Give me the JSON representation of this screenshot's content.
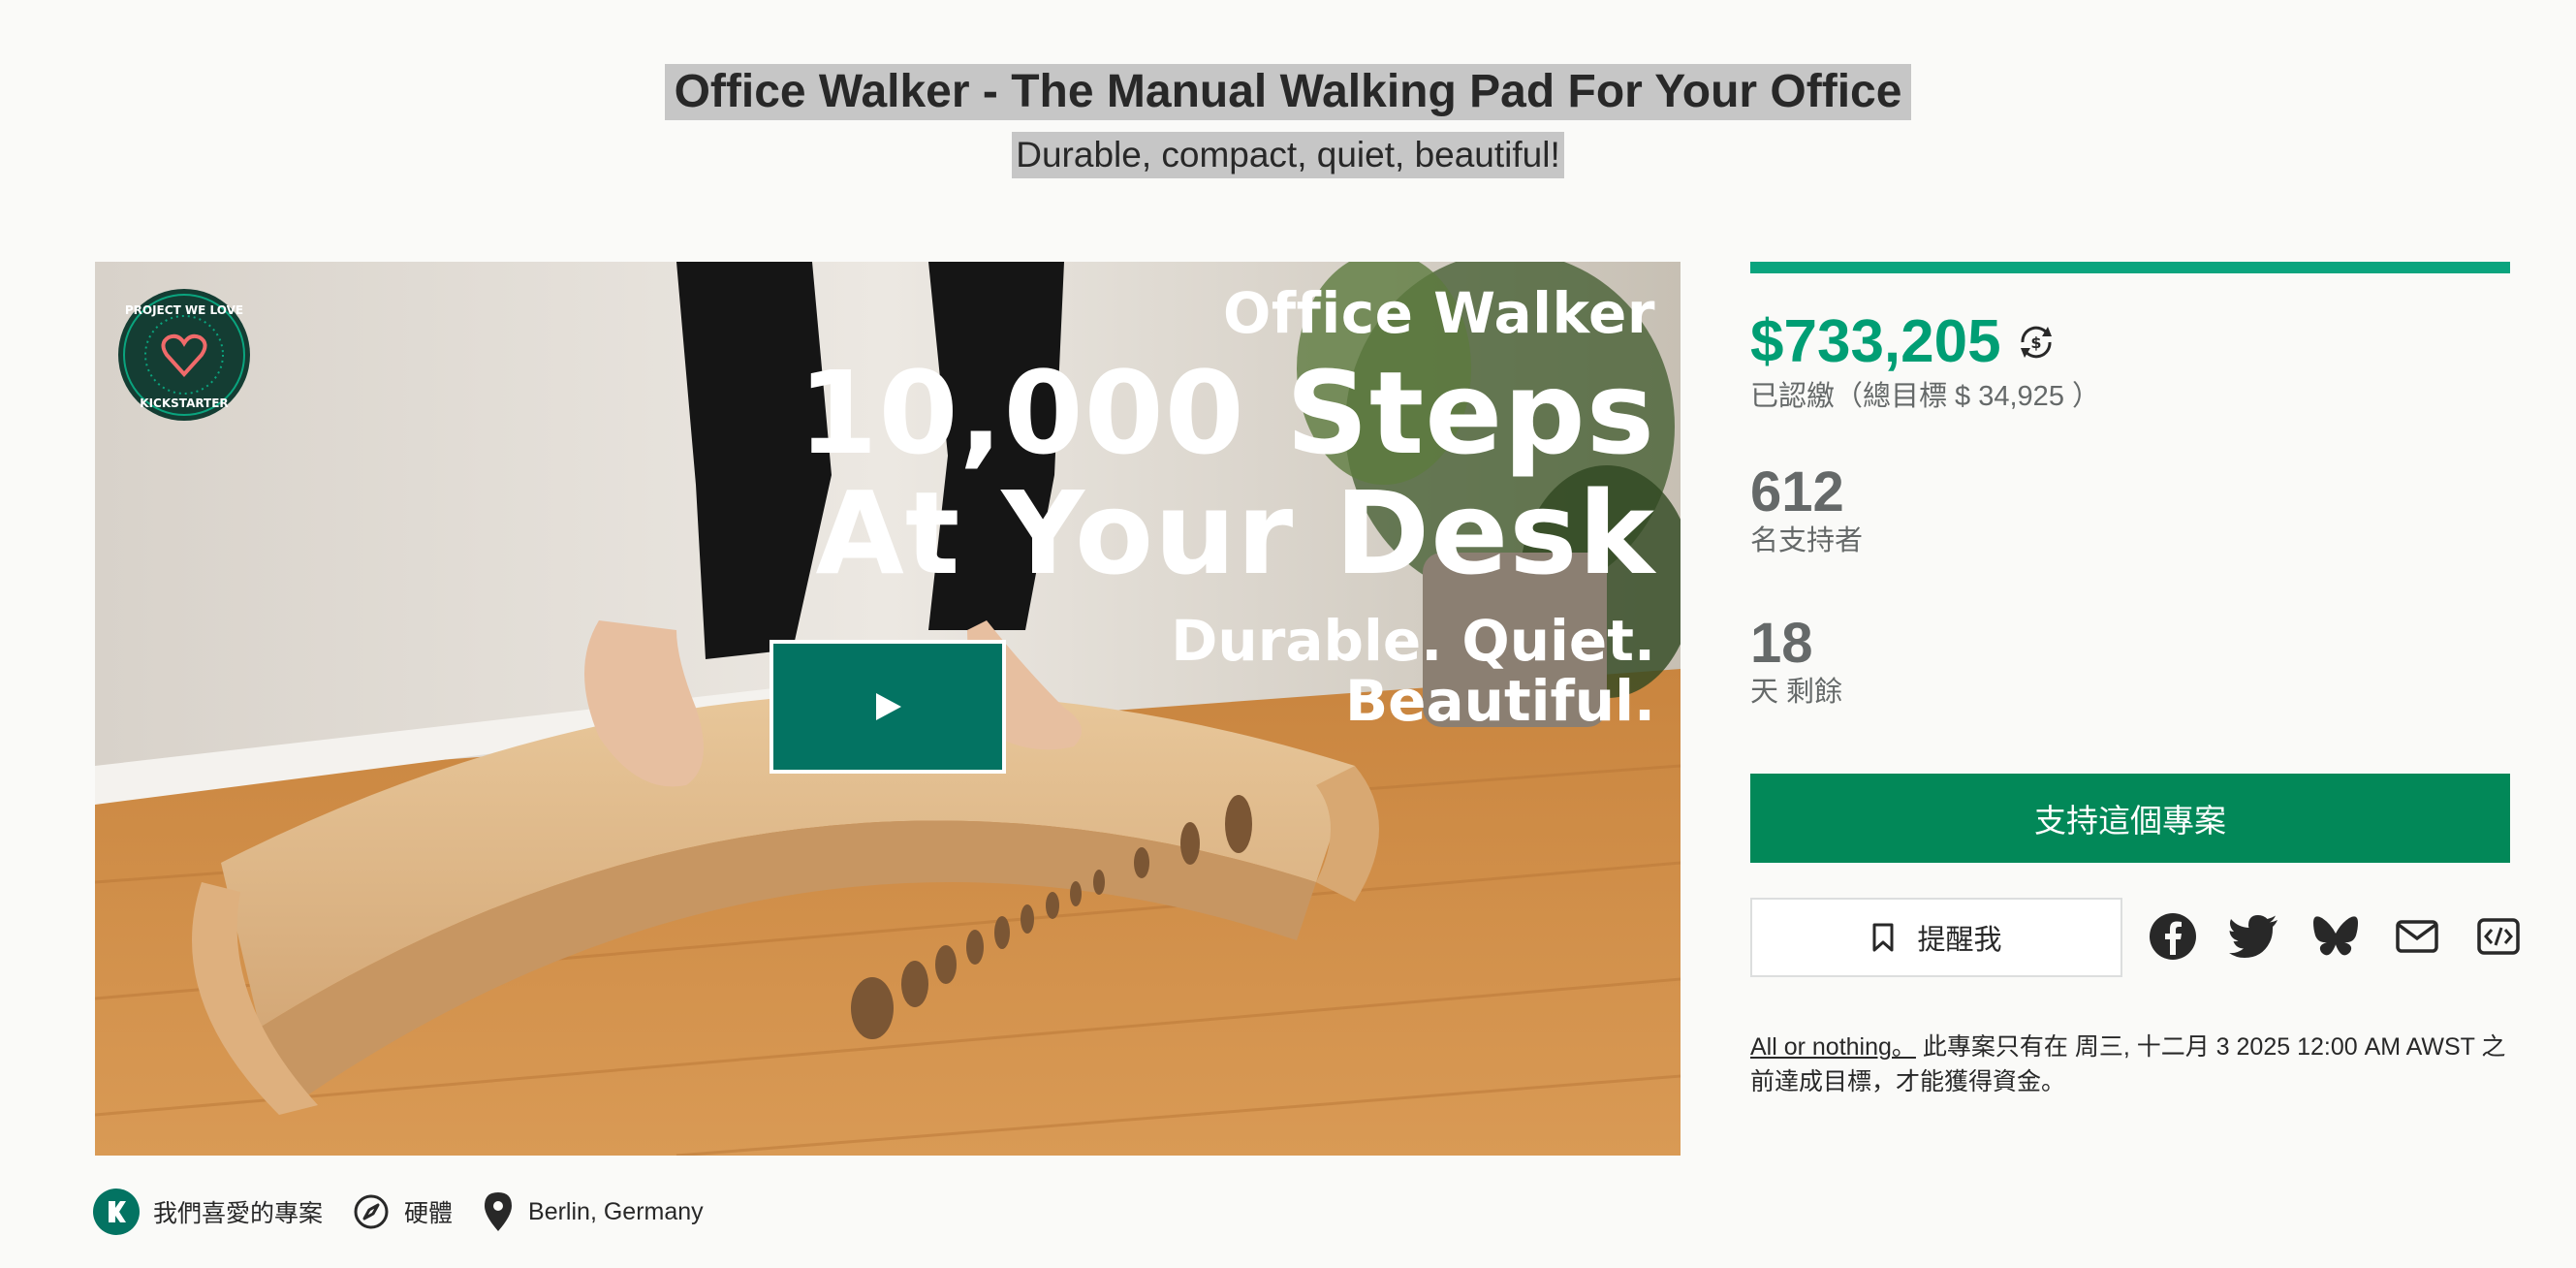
{
  "header": {
    "title": "Office Walker - The Manual Walking Pad For Your Office",
    "subtitle": "Durable, compact, quiet, beautiful!"
  },
  "media": {
    "badge_top": "PROJECT WE LOVE",
    "badge_bottom": "KICKSTARTER",
    "overlay_brand": "Office Walker",
    "overlay_headline_1": "10,000 Steps",
    "overlay_headline_2": "At Your Desk",
    "overlay_tag_1": "Durable. Quiet.",
    "overlay_tag_2": "Beautiful.",
    "play_icon": "play-icon"
  },
  "stats": {
    "progress_fraction": 1.0,
    "pledged": "$733,205",
    "pledged_label": "已認繳（總目標 $ 34,925 ）",
    "backers": "612",
    "backers_label": "名支持者",
    "days": "18",
    "days_label": "天 剩餘"
  },
  "actions": {
    "back_label": "支持這個專案",
    "remind_label": "提醒我",
    "share_icons": [
      "facebook-icon",
      "twitter-icon",
      "bluesky-icon",
      "email-icon",
      "embed-icon"
    ]
  },
  "funding_note": {
    "link": "All or nothing。",
    "text": " 此專案只有在 周三, 十二月 3 2025 12:00 AM AWST 之前達成目標，才能獲得資金。"
  },
  "tags": {
    "pwl": "我們喜愛的專案",
    "category": "硬體",
    "location": "Berlin, Germany"
  },
  "colors": {
    "accent": "#009e74",
    "button": "#028858",
    "play": "#037362",
    "title_highlight": "#c6c6c6"
  }
}
